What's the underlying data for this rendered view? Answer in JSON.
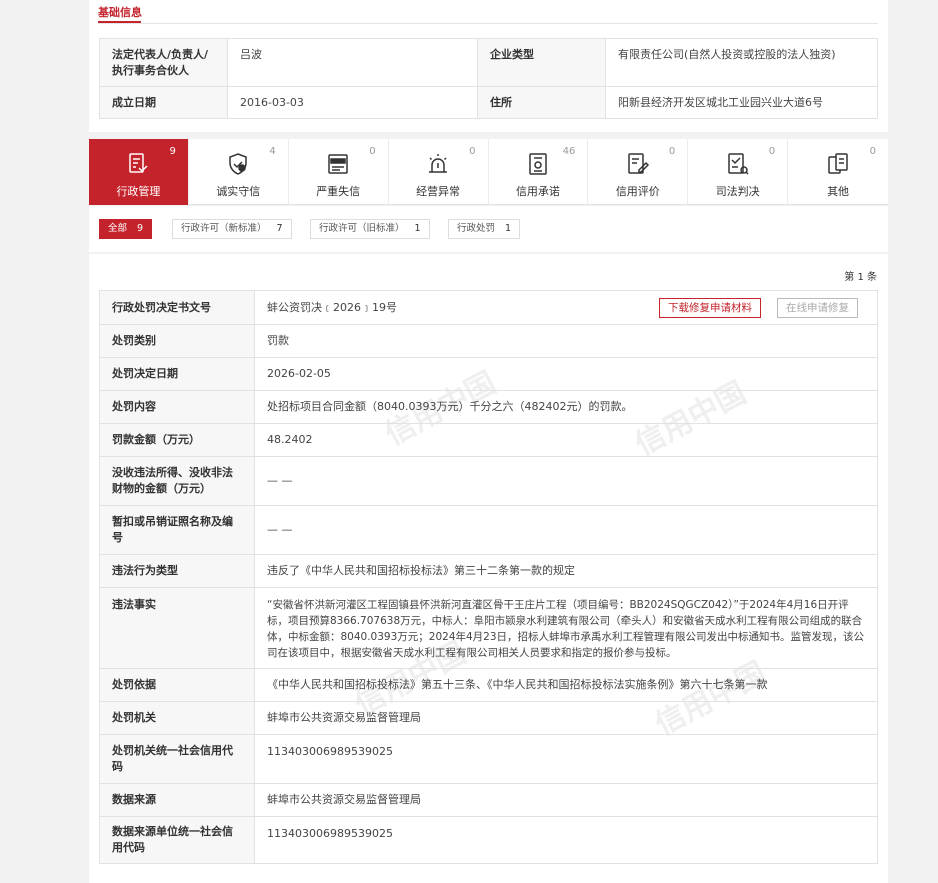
{
  "section": {
    "title": "基础信息"
  },
  "basic": {
    "rows": [
      {
        "l1": "法定代表人/负责人/执行事务合伙人",
        "v1": "吕波",
        "l2": "企业类型",
        "v2": "有限责任公司(自然人投资或控股的法人独资)"
      },
      {
        "l1": "成立日期",
        "v1": "2016-03-03",
        "l2": "住所",
        "v2": "阳新县经济开发区城北工业园兴业大道6号"
      }
    ]
  },
  "tabs": [
    {
      "label": "行政管理",
      "count": "9",
      "icon": "admin-doc-icon"
    },
    {
      "label": "诚实守信",
      "count": "4",
      "icon": "shield-icon"
    },
    {
      "label": "严重失信",
      "count": "0",
      "icon": "dishonest-list-icon"
    },
    {
      "label": "经营异常",
      "count": "0",
      "icon": "alarm-light-icon"
    },
    {
      "label": "信用承诺",
      "count": "46",
      "icon": "promise-doc-icon"
    },
    {
      "label": "信用评价",
      "count": "0",
      "icon": "evaluation-icon"
    },
    {
      "label": "司法判决",
      "count": "0",
      "icon": "judgment-icon"
    },
    {
      "label": "其他",
      "count": "0",
      "icon": "other-doc-icon"
    }
  ],
  "filters": [
    {
      "label": "全部",
      "count": "9"
    },
    {
      "label": "行政许可（新标准）",
      "count": "7"
    },
    {
      "label": "行政许可（旧标准）",
      "count": "1"
    },
    {
      "label": "行政处罚",
      "count": "1"
    }
  ],
  "page_info": "第 1 条",
  "watermark": "信用中国",
  "actions": {
    "download": "下载修复申请材料",
    "online": "在线申请修复"
  },
  "detail": [
    {
      "label": "行政处罚决定书文号",
      "value": "蚌公资罚决﹝2026﹞19号"
    },
    {
      "label": "处罚类别",
      "value": "罚款"
    },
    {
      "label": "处罚决定日期",
      "value": "2026-02-05"
    },
    {
      "label": "处罚内容",
      "value": "处招标项目合同金额（8040.0393万元）千分之六（482402元）的罚款。"
    },
    {
      "label": "罚款金额（万元）",
      "value": "48.2402"
    },
    {
      "label": "没收违法所得、没收非法财物的金额（万元）",
      "value": "— —"
    },
    {
      "label": "暂扣或吊销证照名称及编号",
      "value": "— —"
    },
    {
      "label": "违法行为类型",
      "value": "违反了《中华人民共和国招标投标法》第三十二条第一款的规定"
    },
    {
      "label": "违法事实",
      "value": "“安徽省怀洪新河灌区工程固镇县怀洪新河直灌区骨干王庄片工程（项目编号：BB2024SQGCZ042）”于2024年4月16日开评标，项目预算8366.707638万元，中标人：阜阳市颍泉水利建筑有限公司（牵头人）和安徽省天成水利工程有限公司组成的联合体，中标金额：8040.0393万元；2024年4月23日，招标人蚌埠市承禹水利工程管理有限公司发出中标通知书。监管发现，该公司在该项目中，根据安徽省天成水利工程有限公司相关人员要求和指定的报价参与投标。"
    },
    {
      "label": "处罚依据",
      "value": "《中华人民共和国招标投标法》第五十三条、《中华人民共和国招标投标法实施条例》第六十七条第一款"
    },
    {
      "label": "处罚机关",
      "value": "蚌埠市公共资源交易监督管理局"
    },
    {
      "label": "处罚机关统一社会信用代码",
      "value": "113403006989539025"
    },
    {
      "label": "数据来源",
      "value": "蚌埠市公共资源交易监督管理局"
    },
    {
      "label": "数据来源单位统一社会信用代码",
      "value": "113403006989539025"
    }
  ]
}
